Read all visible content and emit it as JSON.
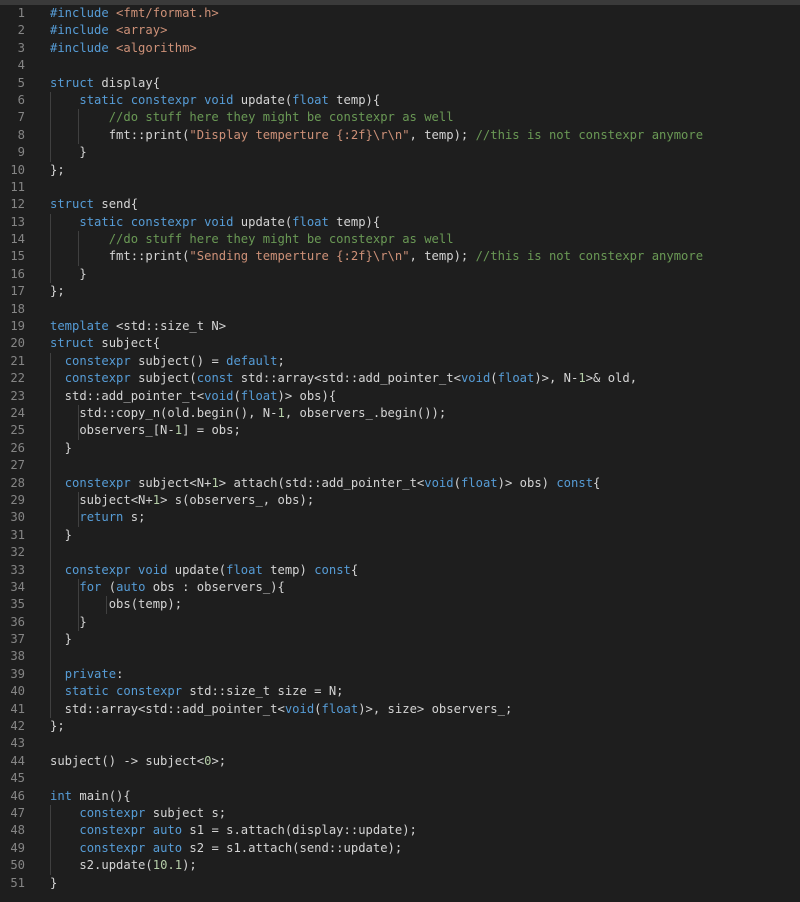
{
  "editor": {
    "background": "#1e1e1e",
    "theme_colors": {
      "keyword": "#569cd6",
      "string": "#ce9178",
      "comment": "#6a9955",
      "number": "#b5cea8",
      "plain": "#d4d4d4",
      "line_number": "#858585"
    },
    "lines": [
      {
        "n": "1",
        "indent": 0,
        "tokens": [
          [
            "pp",
            "#include "
          ],
          [
            "inc",
            "<fmt/format.h>"
          ]
        ]
      },
      {
        "n": "2",
        "indent": 0,
        "tokens": [
          [
            "pp",
            "#include "
          ],
          [
            "inc",
            "<array>"
          ]
        ]
      },
      {
        "n": "3",
        "indent": 0,
        "tokens": [
          [
            "pp",
            "#include "
          ],
          [
            "inc",
            "<algorithm>"
          ]
        ]
      },
      {
        "n": "4",
        "indent": 0,
        "tokens": []
      },
      {
        "n": "5",
        "indent": 0,
        "tokens": [
          [
            "kw",
            "struct"
          ],
          [
            "pl",
            " display{"
          ]
        ]
      },
      {
        "n": "6",
        "indent": 1,
        "tokens": [
          [
            "pl",
            "    "
          ],
          [
            "kw",
            "static constexpr void"
          ],
          [
            "pl",
            " update("
          ],
          [
            "kw",
            "float"
          ],
          [
            "pl",
            " temp){"
          ]
        ]
      },
      {
        "n": "7",
        "indent": 2,
        "tokens": [
          [
            "pl",
            "        "
          ],
          [
            "com",
            "//do stuff here they might be constexpr as well"
          ]
        ]
      },
      {
        "n": "8",
        "indent": 2,
        "tokens": [
          [
            "pl",
            "        fmt::print("
          ],
          [
            "str",
            "\"Display temperture {:2f}\\r\\n\""
          ],
          [
            "pl",
            ", temp); "
          ],
          [
            "com",
            "//this is not constexpr anymore"
          ]
        ]
      },
      {
        "n": "9",
        "indent": 1,
        "tokens": [
          [
            "pl",
            "    }"
          ]
        ]
      },
      {
        "n": "10",
        "indent": 0,
        "tokens": [
          [
            "pl",
            "};"
          ]
        ]
      },
      {
        "n": "11",
        "indent": 0,
        "tokens": []
      },
      {
        "n": "12",
        "indent": 0,
        "tokens": [
          [
            "kw",
            "struct"
          ],
          [
            "pl",
            " send{"
          ]
        ]
      },
      {
        "n": "13",
        "indent": 1,
        "tokens": [
          [
            "pl",
            "    "
          ],
          [
            "kw",
            "static constexpr void"
          ],
          [
            "pl",
            " update("
          ],
          [
            "kw",
            "float"
          ],
          [
            "pl",
            " temp){"
          ]
        ]
      },
      {
        "n": "14",
        "indent": 2,
        "tokens": [
          [
            "pl",
            "        "
          ],
          [
            "com",
            "//do stuff here they might be constexpr as well"
          ]
        ]
      },
      {
        "n": "15",
        "indent": 2,
        "tokens": [
          [
            "pl",
            "        fmt::print("
          ],
          [
            "str",
            "\"Sending temperture {:2f}\\r\\n\""
          ],
          [
            "pl",
            ", temp); "
          ],
          [
            "com",
            "//this is not constexpr anymore"
          ]
        ]
      },
      {
        "n": "16",
        "indent": 1,
        "tokens": [
          [
            "pl",
            "    }"
          ]
        ]
      },
      {
        "n": "17",
        "indent": 0,
        "tokens": [
          [
            "pl",
            "};"
          ]
        ]
      },
      {
        "n": "18",
        "indent": 0,
        "tokens": []
      },
      {
        "n": "19",
        "indent": 0,
        "tokens": [
          [
            "kw",
            "template"
          ],
          [
            "pl",
            " <std::size_t N>"
          ]
        ]
      },
      {
        "n": "20",
        "indent": 0,
        "tokens": [
          [
            "kw",
            "struct"
          ],
          [
            "pl",
            " subject{"
          ]
        ]
      },
      {
        "n": "21",
        "indent": 1,
        "tokens": [
          [
            "pl",
            "  "
          ],
          [
            "kw",
            "constexpr"
          ],
          [
            "pl",
            " subject() = "
          ],
          [
            "kw",
            "default"
          ],
          [
            "pl",
            ";"
          ]
        ]
      },
      {
        "n": "22",
        "indent": 1,
        "tokens": [
          [
            "pl",
            "  "
          ],
          [
            "kw",
            "constexpr"
          ],
          [
            "pl",
            " subject("
          ],
          [
            "kw",
            "const"
          ],
          [
            "pl",
            " std::array<std::add_pointer_t<"
          ],
          [
            "kw",
            "void"
          ],
          [
            "pl",
            "("
          ],
          [
            "kw",
            "float"
          ],
          [
            "pl",
            ")>, N-"
          ],
          [
            "num",
            "1"
          ],
          [
            "pl",
            ">& old,"
          ]
        ]
      },
      {
        "n": "23",
        "indent": 1,
        "tokens": [
          [
            "pl",
            "  std::add_pointer_t<"
          ],
          [
            "kw",
            "void"
          ],
          [
            "pl",
            "("
          ],
          [
            "kw",
            "float"
          ],
          [
            "pl",
            ")> obs){"
          ]
        ]
      },
      {
        "n": "24",
        "indent": 2,
        "tokens": [
          [
            "pl",
            "    std::copy_n(old.begin(), N-"
          ],
          [
            "num",
            "1"
          ],
          [
            "pl",
            ", observers_.begin());"
          ]
        ]
      },
      {
        "n": "25",
        "indent": 2,
        "tokens": [
          [
            "pl",
            "    observers_[N-"
          ],
          [
            "num",
            "1"
          ],
          [
            "pl",
            "] = obs;"
          ]
        ]
      },
      {
        "n": "26",
        "indent": 1,
        "tokens": [
          [
            "pl",
            "  }"
          ]
        ]
      },
      {
        "n": "27",
        "indent": 1,
        "tokens": []
      },
      {
        "n": "28",
        "indent": 1,
        "tokens": [
          [
            "pl",
            "  "
          ],
          [
            "kw",
            "constexpr"
          ],
          [
            "pl",
            " subject<N+"
          ],
          [
            "num",
            "1"
          ],
          [
            "pl",
            "> attach(std::add_pointer_t<"
          ],
          [
            "kw",
            "void"
          ],
          [
            "pl",
            "("
          ],
          [
            "kw",
            "float"
          ],
          [
            "pl",
            ")> obs) "
          ],
          [
            "kw",
            "const"
          ],
          [
            "pl",
            "{"
          ]
        ]
      },
      {
        "n": "29",
        "indent": 2,
        "tokens": [
          [
            "pl",
            "    subject<N+"
          ],
          [
            "num",
            "1"
          ],
          [
            "pl",
            "> s(observers_, obs);"
          ]
        ]
      },
      {
        "n": "30",
        "indent": 2,
        "tokens": [
          [
            "pl",
            "    "
          ],
          [
            "kw",
            "return"
          ],
          [
            "pl",
            " s;"
          ]
        ]
      },
      {
        "n": "31",
        "indent": 1,
        "tokens": [
          [
            "pl",
            "  }"
          ]
        ]
      },
      {
        "n": "32",
        "indent": 1,
        "tokens": []
      },
      {
        "n": "33",
        "indent": 1,
        "tokens": [
          [
            "pl",
            "  "
          ],
          [
            "kw",
            "constexpr void"
          ],
          [
            "pl",
            " update("
          ],
          [
            "kw",
            "float"
          ],
          [
            "pl",
            " temp) "
          ],
          [
            "kw",
            "const"
          ],
          [
            "pl",
            "{"
          ]
        ]
      },
      {
        "n": "34",
        "indent": 2,
        "tokens": [
          [
            "pl",
            "    "
          ],
          [
            "kw",
            "for"
          ],
          [
            "pl",
            " ("
          ],
          [
            "kw",
            "auto"
          ],
          [
            "pl",
            " obs : observers_){"
          ]
        ]
      },
      {
        "n": "35",
        "indent": 3,
        "tokens": [
          [
            "pl",
            "        obs(temp);"
          ]
        ]
      },
      {
        "n": "36",
        "indent": 2,
        "tokens": [
          [
            "pl",
            "    }"
          ]
        ]
      },
      {
        "n": "37",
        "indent": 1,
        "tokens": [
          [
            "pl",
            "  }"
          ]
        ]
      },
      {
        "n": "38",
        "indent": 1,
        "tokens": []
      },
      {
        "n": "39",
        "indent": 1,
        "tokens": [
          [
            "pl",
            "  "
          ],
          [
            "kw",
            "private"
          ],
          [
            "pl",
            ":"
          ]
        ]
      },
      {
        "n": "40",
        "indent": 1,
        "tokens": [
          [
            "pl",
            "  "
          ],
          [
            "kw",
            "static constexpr"
          ],
          [
            "pl",
            " std::size_t size = N;"
          ]
        ]
      },
      {
        "n": "41",
        "indent": 1,
        "tokens": [
          [
            "pl",
            "  std::array<std::add_pointer_t<"
          ],
          [
            "kw",
            "void"
          ],
          [
            "pl",
            "("
          ],
          [
            "kw",
            "float"
          ],
          [
            "pl",
            ")>, size> observers_;"
          ]
        ]
      },
      {
        "n": "42",
        "indent": 0,
        "tokens": [
          [
            "pl",
            "};"
          ]
        ]
      },
      {
        "n": "43",
        "indent": 0,
        "tokens": []
      },
      {
        "n": "44",
        "indent": 0,
        "tokens": [
          [
            "pl",
            "subject() -> subject<"
          ],
          [
            "num",
            "0"
          ],
          [
            "pl",
            ">;"
          ]
        ]
      },
      {
        "n": "45",
        "indent": 0,
        "tokens": []
      },
      {
        "n": "46",
        "indent": 0,
        "tokens": [
          [
            "kw",
            "int"
          ],
          [
            "pl",
            " main(){"
          ]
        ]
      },
      {
        "n": "47",
        "indent": 1,
        "tokens": [
          [
            "pl",
            "    "
          ],
          [
            "kw",
            "constexpr"
          ],
          [
            "pl",
            " subject s;"
          ]
        ]
      },
      {
        "n": "48",
        "indent": 1,
        "tokens": [
          [
            "pl",
            "    "
          ],
          [
            "kw",
            "constexpr auto"
          ],
          [
            "pl",
            " s1 = s.attach(display::update);"
          ]
        ]
      },
      {
        "n": "49",
        "indent": 1,
        "tokens": [
          [
            "pl",
            "    "
          ],
          [
            "kw",
            "constexpr auto"
          ],
          [
            "pl",
            " s2 = s1.attach(send::update);"
          ]
        ]
      },
      {
        "n": "50",
        "indent": 1,
        "tokens": [
          [
            "pl",
            "    s2.update("
          ],
          [
            "num",
            "10.1"
          ],
          [
            "pl",
            ");"
          ]
        ]
      },
      {
        "n": "51",
        "indent": 0,
        "tokens": [
          [
            "pl",
            "}"
          ]
        ]
      }
    ]
  }
}
